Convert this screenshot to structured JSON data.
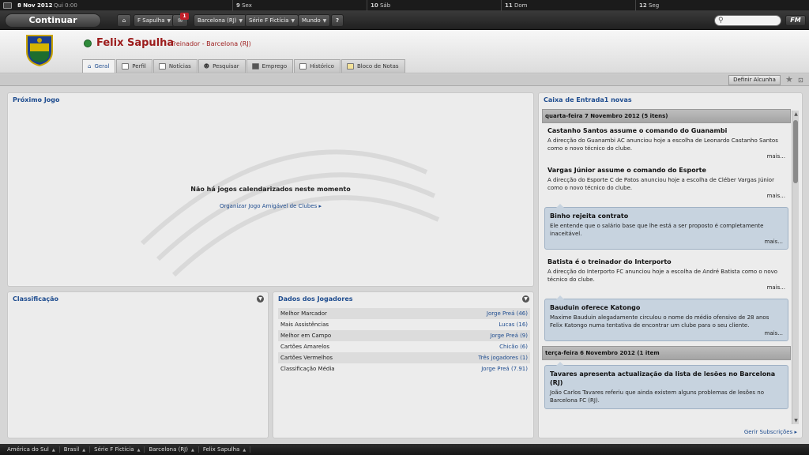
{
  "calendar": {
    "current_date": "8 Nov 2012",
    "current_day_time": "Qui 0:00",
    "days": [
      {
        "num": "9",
        "name": "Sex"
      },
      {
        "num": "10",
        "name": "Sáb"
      },
      {
        "num": "11",
        "name": "Dom"
      },
      {
        "num": "12",
        "name": "Seg"
      }
    ]
  },
  "toolbar": {
    "continue_label": "Continuar",
    "manager_menu": "F Sapulha",
    "messages_badge": "1",
    "club_menu": "Barcelona (RJ)",
    "league_menu": "Série F Fictícia",
    "world_menu": "Mundo",
    "help_label": "?",
    "search_placeholder": "",
    "fm_label": "FM"
  },
  "header": {
    "manager_name": "Felix Sapulha",
    "manager_role": "Treinador - Barcelona (RJ)",
    "tabs": [
      {
        "label": "Geral",
        "active": true
      },
      {
        "label": "Perfil"
      },
      {
        "label": "Notícias"
      },
      {
        "label": "Pesquisar"
      },
      {
        "label": "Emprego"
      },
      {
        "label": "Histórico"
      },
      {
        "label": "Bloco de Notas"
      }
    ]
  },
  "subbar": {
    "nickname_button": "Definir Alcunha"
  },
  "next_game": {
    "title": "Próximo Jogo",
    "empty_text": "Não há jogos calendarizados neste momento",
    "friendly_link": "Organizar Jogo Amigável de Clubes"
  },
  "classification": {
    "title": "Classificação"
  },
  "player_data": {
    "title": "Dados dos Jogadores",
    "rows": [
      {
        "label": "Melhor Marcador",
        "value": "Jorge Preá (46)"
      },
      {
        "label": "Mais Assistências",
        "value": "Lucas (16)"
      },
      {
        "label": "Melhor em Campo",
        "value": "Jorge Preá (9)"
      },
      {
        "label": "Cartões Amarelos",
        "value": "Chicão (6)"
      },
      {
        "label": "Cartões Vermelhos",
        "value": "Três jogadores (1)"
      },
      {
        "label": "Classificação Média",
        "value": "Jorge Preá (7.91)"
      }
    ]
  },
  "inbox": {
    "title": "Caixa de Entrada1 novas",
    "more_label": "mais...",
    "subscriptions_link": "Gerir Subscrições",
    "groups": [
      {
        "date": "quarta-feira 7 Novembro 2012 (5 itens)",
        "messages": [
          {
            "title": "Castanho Santos assume o comando do Guanambi",
            "body": "A direcção do Guanambi AC anunciou hoje a escolha de Leonardo Castanho Santos como o novo técnico do clube.",
            "highlight": false
          },
          {
            "title": "Vargas Júnior assume o comando do Esporte",
            "body": "A direcção do Esporte C de Patos anunciou hoje a escolha de Cléber Vargas Júnior como o novo técnico do clube.",
            "highlight": false
          },
          {
            "title": "Binho rejeita contrato",
            "body": "Ele entende que o salário base que lhe está a ser proposto é completamente inaceitável.",
            "highlight": true
          },
          {
            "title": "Batista é o treinador do Interporto",
            "body": "A direcção do Interporto FC anunciou hoje a escolha de André Batista como o novo técnico do clube.",
            "highlight": false
          },
          {
            "title": "Bauduin oferece Katongo",
            "body": "Maxime Bauduin alegadamente circulou o nome do médio ofensivo de 28 anos Felix Katongo numa tentativa de encontrar um clube para o seu cliente.",
            "highlight": true
          }
        ]
      },
      {
        "date": "terça-feira 6 Novembro 2012 (1 item",
        "messages": [
          {
            "title": "Tavares apresenta actualização da lista de lesões no Barcelona (RJ)",
            "body": "João Carlos Tavares referiu que ainda existem alguns problemas de lesões no Barcelona FC (RJ).",
            "highlight": true
          }
        ]
      }
    ]
  },
  "breadcrumbs": [
    "América do Sul",
    "Brasil",
    "Série F Fictícia",
    "Barcelona (RJ)",
    "Felix Sapulha"
  ]
}
